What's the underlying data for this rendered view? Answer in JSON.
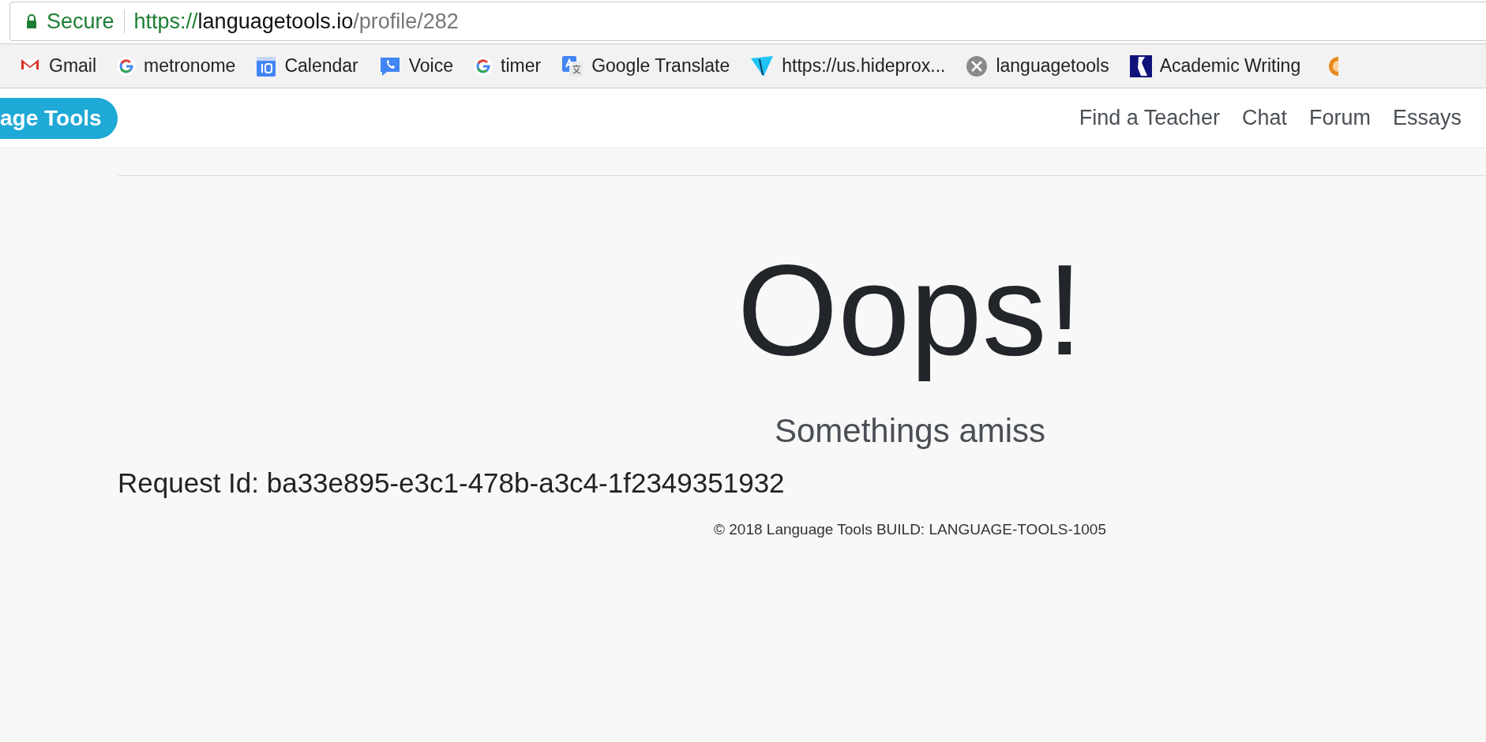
{
  "address_bar": {
    "security": "Secure",
    "url_scheme": "https://",
    "url_host": "languagetools.io",
    "url_path": "/profile/282"
  },
  "bookmarks": [
    {
      "label": "Gmail"
    },
    {
      "label": "metronome"
    },
    {
      "label": "Calendar"
    },
    {
      "label": "Voice"
    },
    {
      "label": "timer"
    },
    {
      "label": "Google Translate"
    },
    {
      "label": "https://us.hideprox..."
    },
    {
      "label": "languagetools"
    },
    {
      "label": "Academic Writing"
    }
  ],
  "navbar": {
    "brand": "age Tools",
    "links": [
      "Find a Teacher",
      "Chat",
      "Forum",
      "Essays"
    ]
  },
  "error": {
    "title": "Oops!",
    "subtitle": "Somethings amiss",
    "request_id": "Request Id: ba33e895-e3c1-478b-a3c4-1f2349351932"
  },
  "footer": "© 2018 Language Tools BUILD: LANGUAGE-TOOLS-1005"
}
